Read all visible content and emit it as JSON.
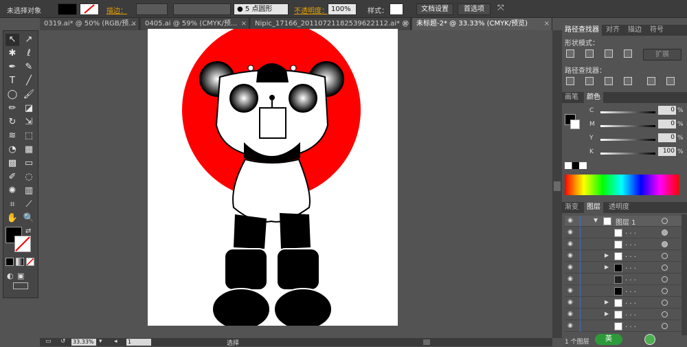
{
  "control_bar": {
    "selection_label": "未选择对象",
    "stroke_label": "描边：",
    "point_label": "5 点圆形",
    "opacity_label": "不透明度：",
    "opacity_value": "100%",
    "style_label": "样式：",
    "doc_setup_label": "文档设置",
    "prefs_label": "首选项"
  },
  "tabs": [
    {
      "label": "0319.ai* @ 50% (RGB/预..."
    },
    {
      "label": "0405.ai @ 59% (CMYK/预..."
    },
    {
      "label": "Nipic_17166_20110721182539622112.ai* @ 2..."
    },
    {
      "label": "未标题-2* @ 33.33% (CMYK/预览)"
    }
  ],
  "tab_close": "×",
  "pathfinder": {
    "tabs": [
      "路径查找器",
      "对齐",
      "描边",
      "符号"
    ],
    "shape_modes_label": "形状模式：",
    "expand_label": "扩展",
    "pathfinders_label": "路径查找器："
  },
  "color_panel": {
    "tabs": [
      "画笔",
      "颜色"
    ],
    "channels": [
      {
        "name": "C",
        "value": "0",
        "fraction": 0.0
      },
      {
        "name": "M",
        "value": "0",
        "fraction": 0.0
      },
      {
        "name": "Y",
        "value": "0",
        "fraction": 0.0
      },
      {
        "name": "K",
        "value": "100",
        "fraction": 1.0
      }
    ],
    "percent": "%"
  },
  "layers_panel": {
    "tabs": [
      "渐变",
      "图层",
      "透明度"
    ],
    "rows": [
      {
        "name": "图层 1",
        "expanded": true
      },
      {
        "name": ". . ."
      },
      {
        "name": ". . ."
      },
      {
        "name": ". . ."
      },
      {
        "name": ". . ."
      },
      {
        "name": ". . ."
      },
      {
        "name": ". . ."
      },
      {
        "name": ". . ."
      },
      {
        "name": ". . ."
      },
      {
        "name": ". . ."
      }
    ],
    "footer_count": "1 个图层"
  },
  "status": {
    "zoom": "33.33%",
    "page": "1",
    "tool_name": "选择"
  },
  "ime": {
    "label": "英"
  },
  "tools": [
    "selection-tool",
    "direct-selection-tool",
    "magic-wand-tool",
    "lasso-tool",
    "pen-tool",
    "curvature-tool",
    "type-tool",
    "line-tool",
    "ellipse-tool",
    "paintbrush-tool",
    "pencil-tool",
    "eraser-tool",
    "rotate-tool",
    "scale-tool",
    "width-tool",
    "free-transform-tool",
    "shape-builder-tool",
    "perspective-tool",
    "mesh-tool",
    "gradient-tool",
    "eyedropper-tool",
    "blend-tool",
    "symbol-sprayer-tool",
    "column-graph-tool",
    "artboard-tool",
    "slice-tool",
    "hand-tool",
    "zoom-tool"
  ],
  "colors": {
    "red_circle": "#ff0000",
    "black": "#000000",
    "white": "#ffffff",
    "ui_dark": "#3c3c3c",
    "accent_orange": "#e8a000"
  }
}
